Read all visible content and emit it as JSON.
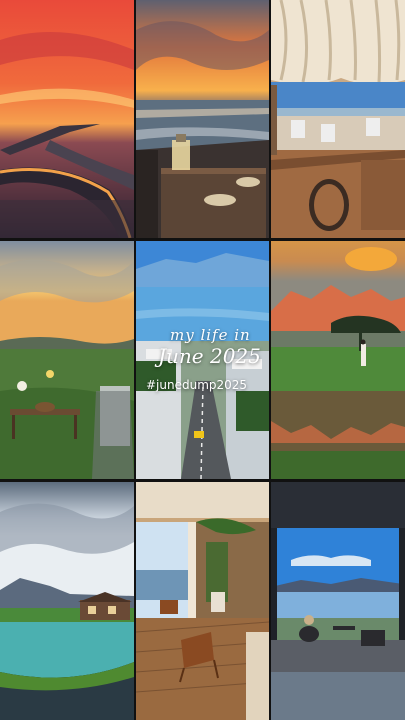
{
  "overlay": {
    "line1": "my life in",
    "line2": "June 2025",
    "hashtag": "#junedump2025"
  },
  "tiles": [
    {
      "name": "sunset-bridge-photo"
    },
    {
      "name": "seaside-table-sunset-photo"
    },
    {
      "name": "canopy-restaurant-photo"
    },
    {
      "name": "meadow-picnic-photo"
    },
    {
      "name": "coastal-town-street-photo"
    },
    {
      "name": "mountain-lake-reflection-photo"
    },
    {
      "name": "lakeside-cabin-photo"
    },
    {
      "name": "villa-terrace-photo"
    },
    {
      "name": "window-lake-view-photo"
    }
  ]
}
